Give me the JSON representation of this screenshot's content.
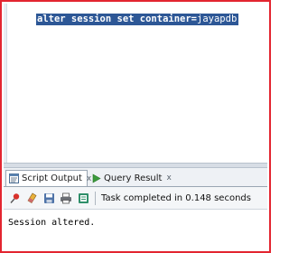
{
  "editor": {
    "sql_keywords": "alter session set container=",
    "sql_value": "jayapdb"
  },
  "results_panel": {
    "tabs": [
      {
        "label": "Script Output",
        "close": "x",
        "active": true,
        "icon": "script-output-icon"
      },
      {
        "label": "Query Result",
        "close": "x",
        "active": false,
        "icon": "run-arrow-icon"
      }
    ],
    "toolbar": {
      "buttons": [
        "pin-icon",
        "eraser-icon",
        "save-icon",
        "print-icon",
        "export-icon"
      ],
      "status": "Task completed in 0.148 seconds"
    },
    "output_lines": [
      "Session altered."
    ]
  },
  "colors": {
    "frame_border": "#e32530",
    "selection": "#2d5796",
    "run_arrow": "#3c9a3c"
  }
}
